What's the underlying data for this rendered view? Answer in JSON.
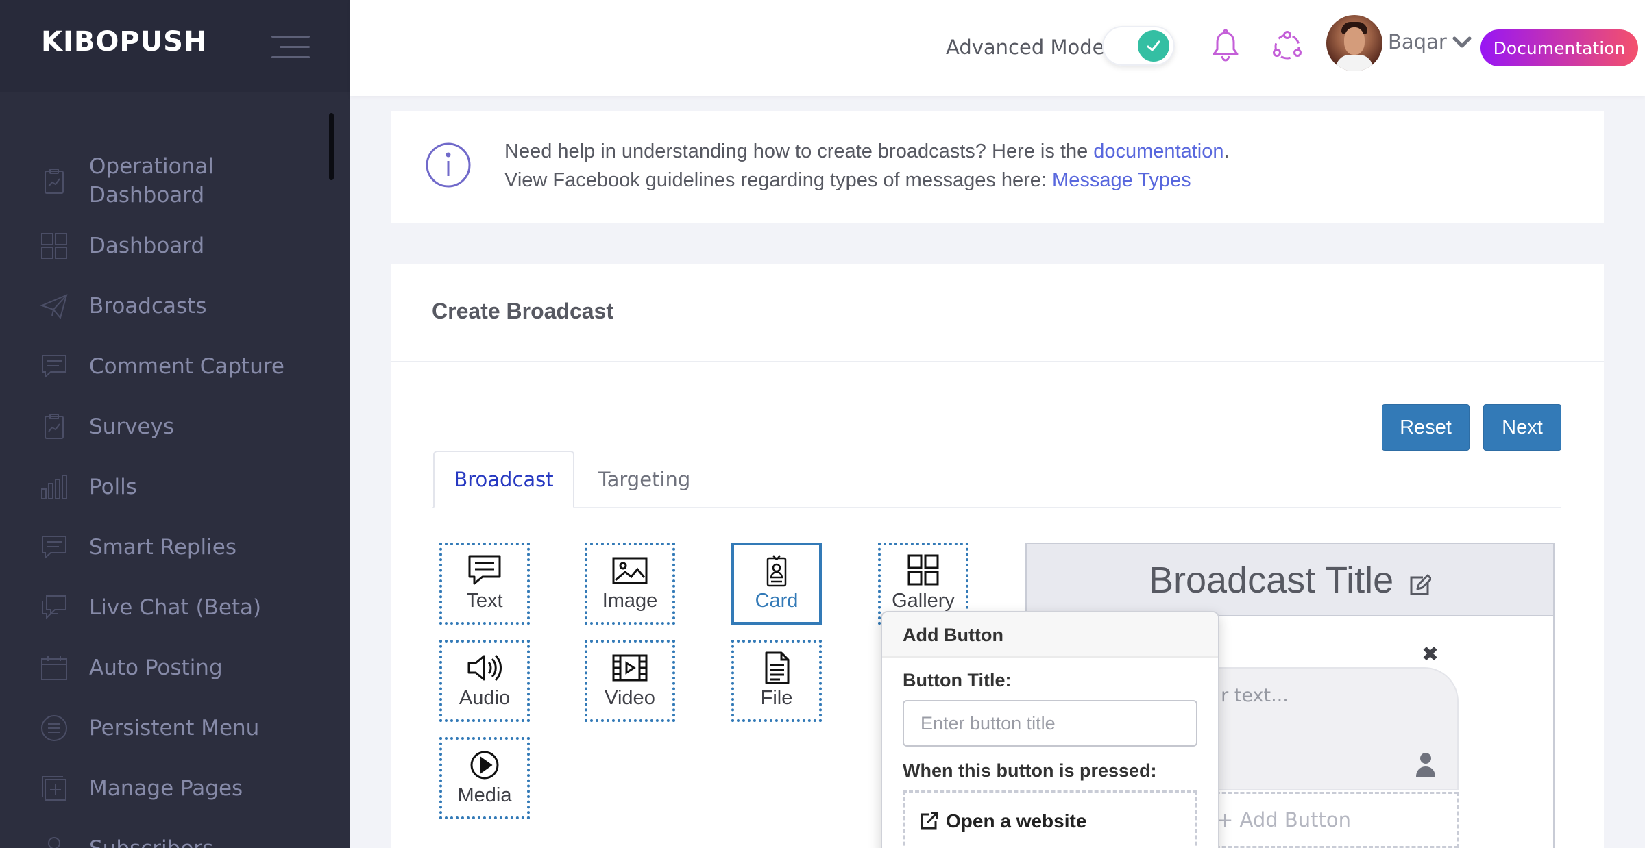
{
  "brand": {
    "name": "KIBOPUSH"
  },
  "sidebar": {
    "items": [
      {
        "label": "Operational Dashboard",
        "icon": "clipboard-chart-icon"
      },
      {
        "label": "Dashboard",
        "icon": "grid-icon"
      },
      {
        "label": "Broadcasts",
        "icon": "paper-plane-icon"
      },
      {
        "label": "Comment Capture",
        "icon": "comment-icon"
      },
      {
        "label": "Surveys",
        "icon": "clipboard-chart-icon"
      },
      {
        "label": "Polls",
        "icon": "bar-chart-icon"
      },
      {
        "label": "Smart Replies",
        "icon": "comment-icon"
      },
      {
        "label": "Live Chat (Beta)",
        "icon": "chat-icon"
      },
      {
        "label": "Auto Posting",
        "icon": "calendar-icon"
      },
      {
        "label": "Persistent Menu",
        "icon": "menu-circle-icon"
      },
      {
        "label": "Manage Pages",
        "icon": "add-page-icon"
      },
      {
        "label": "Subscribers",
        "icon": "user-icon"
      }
    ]
  },
  "header": {
    "advanced_mode_label": "Advanced Mode",
    "advanced_mode_on": true,
    "username": "Baqar",
    "documentation_button": "Documentation"
  },
  "info": {
    "line1_prefix": "Need help in understanding how to create broadcasts? Here is the ",
    "line1_link": "documentation",
    "line1_suffix": ".",
    "line2_prefix": "View Facebook guidelines regarding types of messages here: ",
    "line2_link": "Message Types"
  },
  "panel": {
    "title": "Create Broadcast",
    "reset_label": "Reset",
    "next_label": "Next",
    "tabs": [
      {
        "label": "Broadcast",
        "active": true
      },
      {
        "label": "Targeting",
        "active": false
      }
    ],
    "components": [
      {
        "label": "Text",
        "icon": "text-bubble-icon"
      },
      {
        "label": "Image",
        "icon": "image-icon"
      },
      {
        "label": "Card",
        "icon": "card-icon",
        "selected": true
      },
      {
        "label": "Gallery",
        "icon": "gallery-icon"
      },
      {
        "label": "Audio",
        "icon": "speaker-icon"
      },
      {
        "label": "Video",
        "icon": "film-icon"
      },
      {
        "label": "File",
        "icon": "file-icon"
      },
      {
        "label": "Media",
        "icon": "play-circle-icon"
      }
    ]
  },
  "preview": {
    "title": "Broadcast Title",
    "text_placeholder": "ur text...",
    "add_button_label": "+ Add Button"
  },
  "popover": {
    "title": "Add Button",
    "button_title_label": "Button Title:",
    "button_title_placeholder": "Enter button title",
    "pressed_label": "When this button is pressed:",
    "option_open_website": "Open a website"
  },
  "colors": {
    "sidebar_bg": "#2c2e3e",
    "accent_blue": "#337ab7",
    "link": "#5867dd",
    "toggle_on": "#34bfa3",
    "doc_gradient_start": "#9816f4",
    "doc_gradient_end": "#f4516c"
  }
}
